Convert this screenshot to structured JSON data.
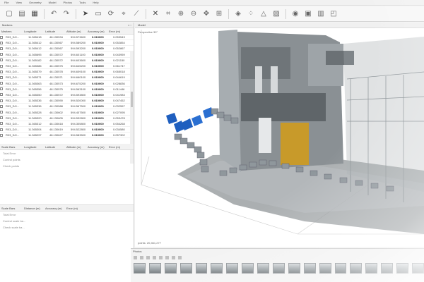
{
  "menu": [
    "File",
    "View",
    "Geometry",
    "Model",
    "Photos",
    "Tools",
    "Help"
  ],
  "left_panel": {
    "title": "Markers",
    "columns": [
      "Markers",
      "Longitude",
      "Latitude",
      "Altitude (m)",
      "Accuracy (m)",
      "Error (m)"
    ],
    "rows": [
      [
        "R03_DJI...",
        "11.365418",
        "48.130534",
        "594.573600",
        "0.010000",
        "0.053543"
      ],
      [
        "R03_DJI...",
        "11.365412",
        "48.130567",
        "594.589200",
        "0.010000",
        "0.052854"
      ],
      [
        "R03_DJI...",
        "11.365412",
        "48.130567",
        "594.593200",
        "0.010000",
        "0.052867"
      ],
      [
        "R03_DJI...",
        "11.365695",
        "48.130572",
        "594.601100",
        "0.010000",
        "0.043959"
      ],
      [
        "R03_DJI...",
        "11.365182",
        "48.130572",
        "594.603600",
        "0.010000",
        "0.021150"
      ],
      [
        "R03_DJI...",
        "11.365386",
        "48.130575",
        "594.645200",
        "0.010000",
        "0.061747"
      ],
      [
        "R03_DJI...",
        "11.365379",
        "48.130578",
        "594.609100",
        "0.010000",
        "0.065018"
      ],
      [
        "R03_DJI...",
        "11.365371",
        "48.130571",
        "594.660100",
        "0.010000",
        "0.044619"
      ],
      [
        "R03_DJI...",
        "11.365363",
        "48.130573",
        "594.675200",
        "0.010000",
        "0.028836"
      ],
      [
        "R03_DJI...",
        "11.365356",
        "48.130575",
        "594.563100",
        "0.010000",
        "0.011446"
      ],
      [
        "R03_DJI...",
        "11.365350",
        "48.130572",
        "594.593800",
        "0.010000",
        "0.041983"
      ],
      [
        "R03_DJI...",
        "11.365336",
        "48.130590",
        "594.520000",
        "0.010000",
        "0.047452"
      ],
      [
        "R03_DJI...",
        "11.365336",
        "48.130588",
        "594.567500",
        "0.010000",
        "0.032557"
      ],
      [
        "R03_DJI...",
        "11.365328",
        "48.130602",
        "594.407500",
        "0.010000",
        "0.027095"
      ],
      [
        "R03_DJI...",
        "11.365320",
        "48.130605",
        "594.532800",
        "0.010000",
        "0.053478"
      ],
      [
        "R03_DJI...",
        "11.365312",
        "48.130618",
        "594.305800",
        "0.010000",
        "0.054268"
      ],
      [
        "R03_DJI...",
        "11.365304",
        "48.130619",
        "594.522800",
        "0.010000",
        "0.034580"
      ],
      [
        "R03_DJI...",
        "11.365297",
        "48.130627",
        "594.583500",
        "0.010000",
        "0.057302"
      ]
    ],
    "scale_columns": [
      "Scale Bars",
      "Longitude",
      "Latitude",
      "Altitude (m)",
      "Accuracy (m)",
      "Error (m)"
    ],
    "scale_rows": [
      "Total Error",
      "Control points",
      "Check points"
    ],
    "bottom_columns": [
      "Scale Bars",
      "Distance (m)",
      "Accuracy (m)",
      "Error (m)"
    ],
    "bottom_rows": [
      "Total Error",
      "Control scale ba...",
      "Check scale ba..."
    ]
  },
  "viewport": {
    "title": "Model",
    "perspective": "Perspective 30°",
    "points": "points: 20,461,277"
  },
  "photos_panel": {
    "title": "Photos",
    "thumb_count": 19
  }
}
